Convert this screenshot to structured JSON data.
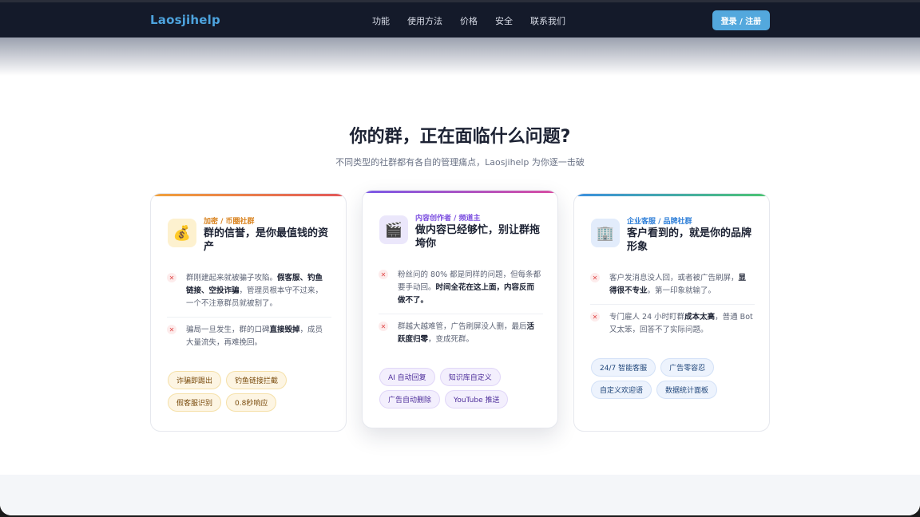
{
  "nav": {
    "logo": "Laosjihelp",
    "items": [
      "功能",
      "使用方法",
      "价格",
      "安全",
      "联系我们"
    ],
    "login": "登录 / 注册"
  },
  "section": {
    "title": "你的群，正在面临什么问题?",
    "subtitle": "不同类型的社群都有各自的管理痛点，Laosjihelp 为你逐一击破"
  },
  "cards": [
    {
      "icon": "money-bag-icon",
      "tag": "加密 / 币圈社群",
      "title": "群的信誉，是你最值钱的资产",
      "accent": "#f0a23b",
      "points": [
        {
          "pre": "群刚建起来就被骗子攻陷。",
          "bold": "假客服、钓鱼链接、空投诈骗",
          "post": "，管理员根本守不过来，一个不注意群员就被割了。"
        },
        {
          "pre": "骗局一旦发生，群的口碑",
          "bold": "直接毁掉",
          "post": "，成员大量流失，再难挽回。"
        }
      ],
      "chips": [
        "诈骗即踢出",
        "钓鱼链接拦截",
        "假客服识别",
        "0.8秒响应"
      ]
    },
    {
      "icon": "clapper-board-icon",
      "tag": "内容创作者 / 频道主",
      "title": "做内容已经够忙，别让群拖垮你",
      "accent": "#7b5be8",
      "points": [
        {
          "pre": "粉丝问的 80% 都是同样的问题，但每条都要手动回。",
          "bold": "时间全花在这上面，内容反而做不了。",
          "post": ""
        },
        {
          "pre": "群越大越难管，广告刷屏没人删，最后",
          "bold": "活跃度归零",
          "post": "，变成死群。"
        }
      ],
      "chips": [
        "AI 自动回复",
        "知识库自定义",
        "广告自动删除",
        "YouTube 推送"
      ]
    },
    {
      "icon": "office-building-icon",
      "tag": "企业客服 / 品牌社群",
      "title": "客户看到的，就是你的品牌形象",
      "accent": "#3b8fe0",
      "points": [
        {
          "pre": "客户发消息没人回，或者被广告刷屏，",
          "bold": "显得很不专业",
          "post": "。第一印象就输了。"
        },
        {
          "pre": "专门雇人 24 小时盯群",
          "bold": "成本太高",
          "post": "，普通 Bot 又太笨，回答不了实际问题。"
        }
      ],
      "chips": [
        "24/7 智能客服",
        "广告零容忍",
        "自定义欢迎语",
        "数据统计面板"
      ]
    }
  ]
}
